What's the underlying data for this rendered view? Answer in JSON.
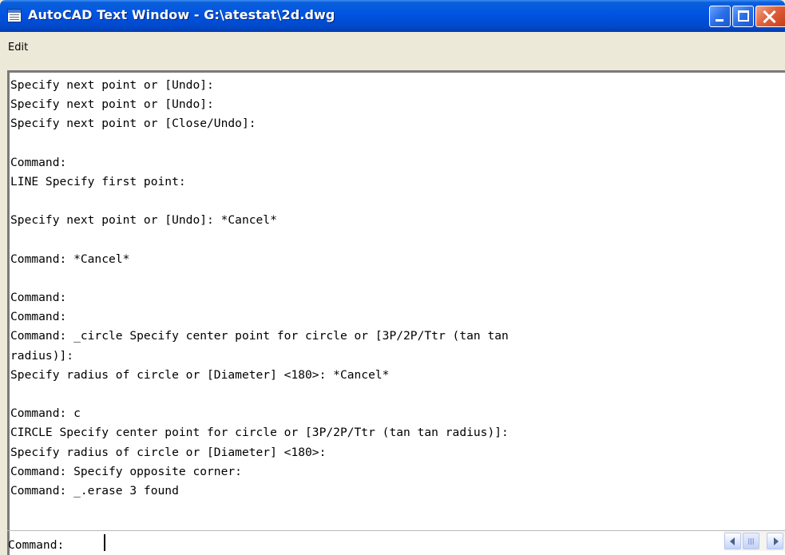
{
  "window": {
    "title": "AutoCAD Text Window - G:\\atestat\\2d.dwg",
    "icon": "app-window-icon"
  },
  "menu": {
    "items": [
      {
        "label": "Edit"
      }
    ]
  },
  "history": {
    "lines": [
      "Specify next point or [Undo]:",
      "Specify next point or [Undo]:",
      "Specify next point or [Close/Undo]:",
      "",
      "Command:",
      "LINE Specify first point:",
      "",
      "Specify next point or [Undo]: *Cancel*",
      "",
      "Command: *Cancel*",
      "",
      "Command:",
      "Command:",
      "Command: _circle Specify center point for circle or [3P/2P/Ttr (tan tan",
      "radius)]:",
      "Specify radius of circle or [Diameter] <180>: *Cancel*",
      "",
      "Command: c",
      "CIRCLE Specify center point for circle or [3P/2P/Ttr (tan tan radius)]:",
      "Specify radius of circle or [Diameter] <180>:",
      "Command: Specify opposite corner:",
      "Command: _.erase 3 found"
    ]
  },
  "command_line": {
    "prompt": "Command:",
    "value": ""
  },
  "colors": {
    "titlebar": "#0054e3",
    "close_button": "#e0623d",
    "window_bg": "#ece9d8",
    "text_bg": "#ffffff"
  }
}
